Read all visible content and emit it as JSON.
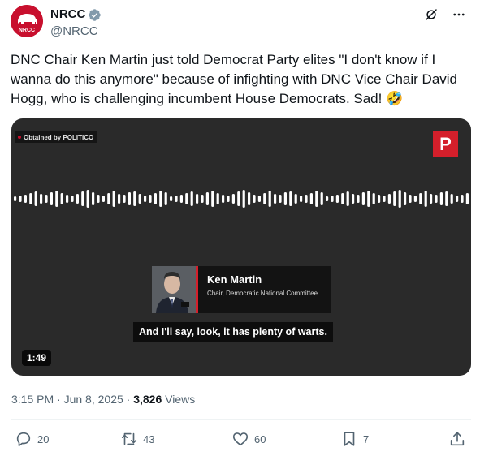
{
  "author": {
    "display_name": "NRCC",
    "handle": "@NRCC",
    "avatar_text": "NRCC",
    "verified": true,
    "brand_color": "#c8102e"
  },
  "header_icons": [
    "grok-icon",
    "more-icon"
  ],
  "tweet": {
    "text": "DNC Chair Ken Martin just told Democrat Party elites \"I don't know if I wanna do this anymore\" because of infighting with DNC Vice Chair David Hogg, who is challenging incumbent House Democrats. Sad! ",
    "emoji": "🤣"
  },
  "media": {
    "badge": "Obtained by POLITICO",
    "logo_letter": "P",
    "lower_third": {
      "name": "Ken Martin",
      "title": "Chair, Democratic National Committee"
    },
    "caption": "And I'll say, look, it has plenty of warts.",
    "duration": "1:49",
    "accent_color": "#d41f2b"
  },
  "meta": {
    "time": "3:15 PM",
    "separator": " · ",
    "date": "Jun 8, 2025",
    "views_count": "3,826",
    "views_label": " Views"
  },
  "actions": {
    "replies": "20",
    "reposts": "43",
    "likes": "60",
    "bookmarks": "7"
  }
}
